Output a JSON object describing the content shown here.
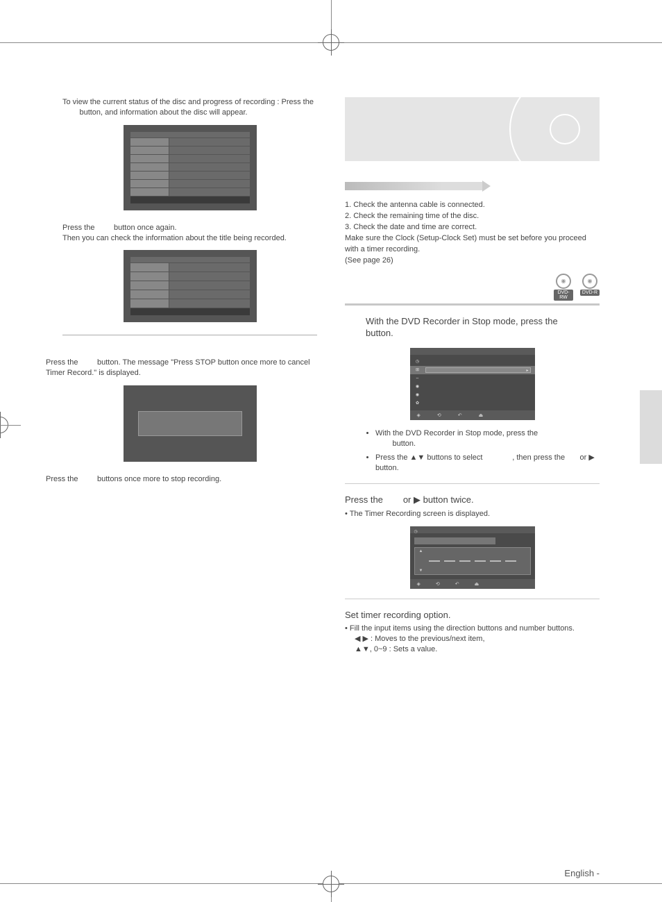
{
  "left": {
    "para1_a": "To view the current status of the disc and progress of recording : Press the ",
    "para1_b": " button, and information about the disc will appear.",
    "para2_a": "Press the ",
    "para2_b": " button once again.",
    "para2_c": "Then you can check the information about the title being recorded.",
    "para3_a": "Press the ",
    "para3_b": " button. The message \"Press STOP button once more to cancel Timer Record.\" is displayed.",
    "para4_a": "Press the ",
    "para4_b": " buttons once more to stop recording."
  },
  "right": {
    "steps": {
      "s1": "1. Check the antenna cable is connected.",
      "s2": "2. Check the remaining time of the disc.",
      "s3": "3. Check the date and time are correct.",
      "note1": "Make sure the Clock (Setup-Clock Set) must be set before you proceed with a timer recording.",
      "note2": "(See page 26)"
    },
    "badges": {
      "rw": "DVD-RW",
      "r": "DVD-R"
    },
    "step1_a": "With the DVD Recorder in Stop mode, press the ",
    "step1_b": " button.",
    "menu_foot": {
      "a": "◈",
      "b": "⟲",
      "c": "↶",
      "d": "⏏"
    },
    "bullets": {
      "b1_a": "With the DVD Recorder in Stop mode, press the ",
      "b1_b": " button.",
      "b2_a": "Press the ▲▼ buttons to select ",
      "b2_b": ", then press the ",
      "b2_c": " or  ▶ button."
    },
    "step2_a": "Press the ",
    "step2_b": " or ▶ button twice.",
    "step2_sub": "• The Timer Recording screen is displayed.",
    "step3_head": "Set timer recording option.",
    "step3_b1": "• Fill the input items using the direction buttons and number buttons.",
    "step3_b2": "◀ ▶ : Moves to the previous/next item,",
    "step3_b3": "▲▼, 0~9 : Sets a value."
  },
  "footer": "English -"
}
